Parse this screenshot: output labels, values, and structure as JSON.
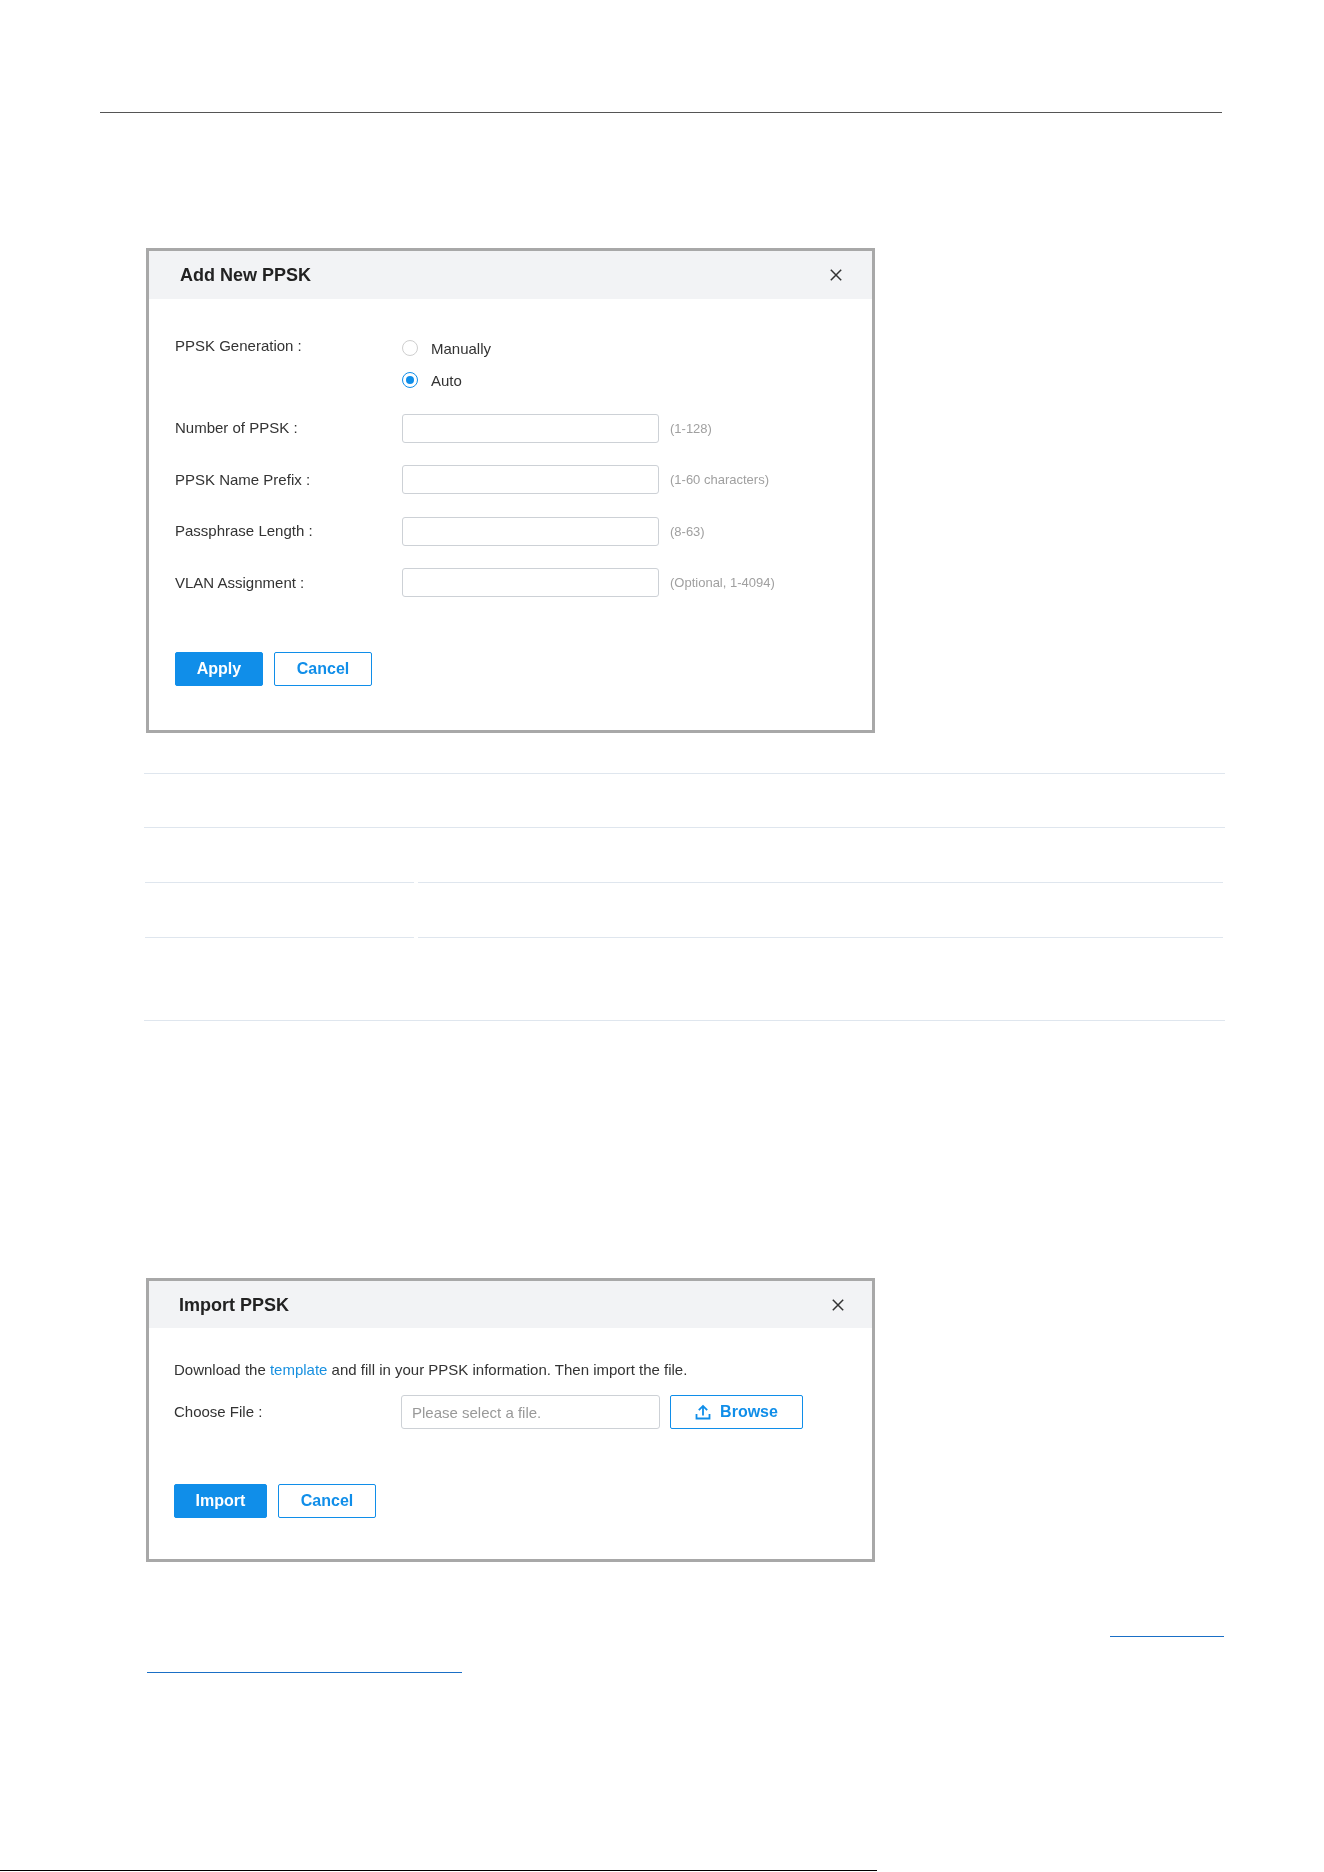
{
  "add_dialog": {
    "title": "Add New PPSK",
    "generation": {
      "label": "PPSK Generation :",
      "options": [
        {
          "label": "Manually",
          "selected": false
        },
        {
          "label": "Auto",
          "selected": true
        }
      ]
    },
    "fields": [
      {
        "label": "Number of PPSK :",
        "hint": "(1-128)"
      },
      {
        "label": "PPSK Name Prefix :",
        "hint": "(1-60 characters)"
      },
      {
        "label": "Passphrase Length :",
        "hint": "(8-63)"
      },
      {
        "label": "VLAN Assignment :",
        "hint": "(Optional, 1-4094)"
      }
    ],
    "buttons": [
      {
        "label": "Apply",
        "kind": "primary"
      },
      {
        "label": "Cancel",
        "kind": "secondary"
      }
    ]
  },
  "import_dialog": {
    "title": "Import PPSK",
    "instruction": {
      "before": "Download the ",
      "link": "template",
      "after": " and fill in your PPSK information. Then import the file."
    },
    "file": {
      "label": "Choose File :",
      "placeholder": "Please select a file.",
      "browse": "Browse"
    },
    "buttons": [
      {
        "label": "Import",
        "kind": "primary"
      },
      {
        "label": "Cancel",
        "kind": "secondary"
      }
    ]
  }
}
